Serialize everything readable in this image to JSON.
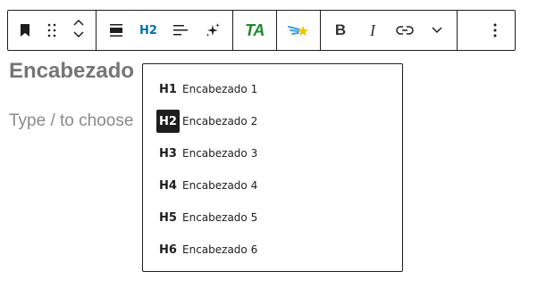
{
  "toolbar": {
    "block_icon": "bookmark-icon",
    "drag_icon": "drag-handle-icon",
    "move_up_icon": "chevron-up-icon",
    "move_down_icon": "chevron-down-icon",
    "align_icon": "align-icon",
    "heading_level": "H2",
    "text_align_icon": "text-align-left-icon",
    "ai_icon": "sparkles-icon",
    "ta_label": "TA",
    "plugin_icon": "comet-star-icon",
    "bold_label": "B",
    "italic_label": "I",
    "link_icon": "link-icon",
    "more_formats_icon": "chevron-down-icon",
    "options_icon": "more-vertical-icon"
  },
  "editor": {
    "heading_text": "Encabezado",
    "placeholder_text": "Type / to choose"
  },
  "heading_menu": {
    "items": [
      {
        "level": "H1",
        "label": "Encabezado 1"
      },
      {
        "level": "H2",
        "label": "Encabezado 2"
      },
      {
        "level": "H3",
        "label": "Encabezado 3"
      },
      {
        "level": "H4",
        "label": "Encabezado 4"
      },
      {
        "level": "H5",
        "label": "Encabezado 5"
      },
      {
        "level": "H6",
        "label": "Encabezado 6"
      }
    ],
    "selected": "H2"
  },
  "colors": {
    "heading_accent": "#0073aa",
    "ta_green": "#1a8a2a",
    "border": "#1e1e1e"
  }
}
